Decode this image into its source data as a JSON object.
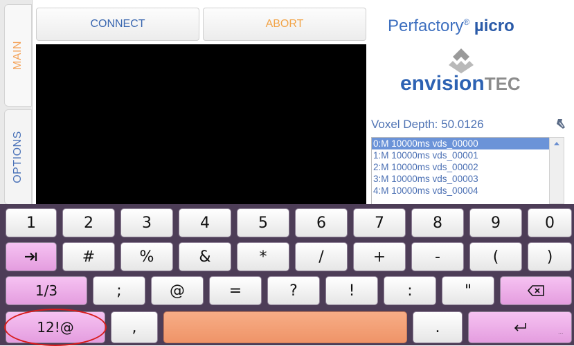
{
  "sidebar": {
    "tabs": [
      {
        "label": "MAIN"
      },
      {
        "label": "OPTIONS"
      }
    ]
  },
  "toolbar": {
    "connect_label": "CONNECT",
    "abort_label": "ABORT"
  },
  "brand": {
    "product": "Perfactory",
    "registered": "®",
    "product_suffix": "µicro",
    "company_main": "envision",
    "company_tec": "TEC"
  },
  "job": {
    "voxel_depth_label": "Voxel Depth: 50.0126",
    "slices": [
      "0:M 10000ms vds_00000",
      "1:M 10000ms vds_00001",
      "2:M 10000ms vds_00002",
      "3:M 10000ms vds_00003",
      "4:M 10000ms vds_00004"
    ]
  },
  "keyboard": {
    "row1": [
      "1",
      "2",
      "3",
      "4",
      "5",
      "6",
      "7",
      "8",
      "9",
      "0"
    ],
    "row2": [
      "#",
      "%",
      "&",
      "*",
      "/",
      "+",
      "-",
      "(",
      ")"
    ],
    "row3": [
      "1/3",
      ";",
      "@",
      "=",
      "?",
      "!",
      ":",
      "\""
    ],
    "row4": [
      "12!@",
      ",",
      "."
    ],
    "icons": {
      "tab": "tab-arrow-icon",
      "backspace": "backspace-icon",
      "enter": "enter-icon"
    }
  },
  "colors": {
    "accent_blue": "#3d6fbf",
    "accent_orange": "#f2a448",
    "keyboard_bg": "#4d3d57",
    "pink_key": "#e49ddf",
    "space_key": "#ef9468",
    "highlight": "#d81c1c"
  }
}
